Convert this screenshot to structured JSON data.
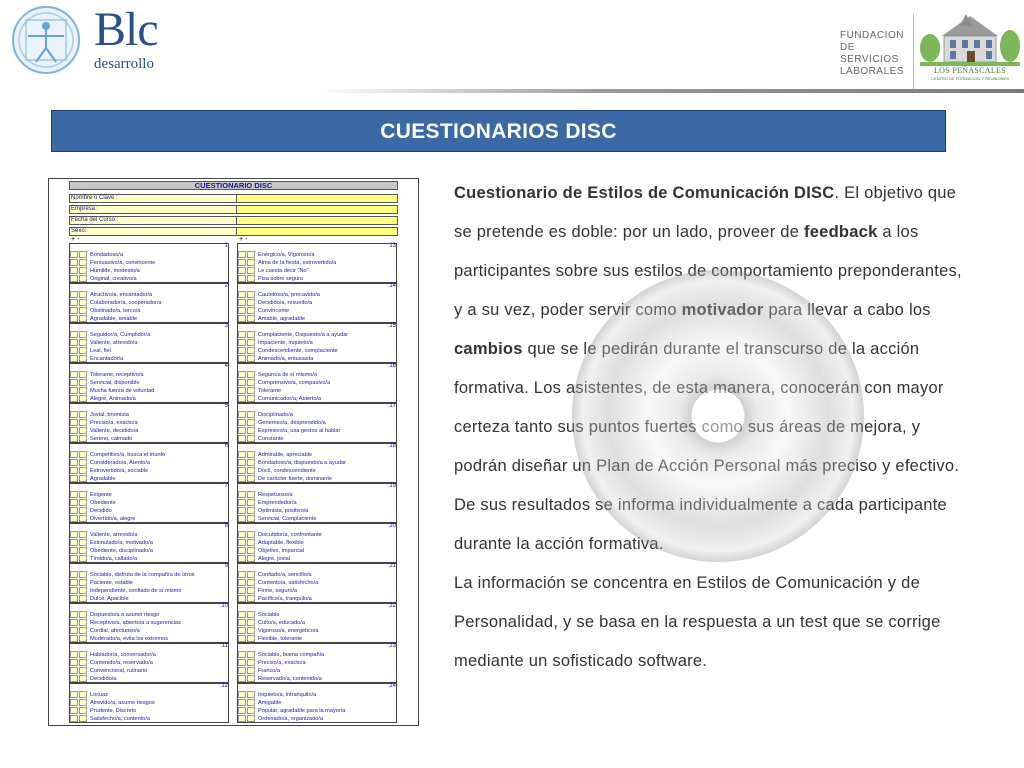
{
  "header": {
    "blc_logo": {
      "name": "Blc",
      "sub": "desarrollo"
    },
    "fsl_logo": {
      "lines": [
        "FUNDACION",
        "DE SERVICIOS",
        "LABORALES"
      ]
    },
    "penascales_logo": {
      "name": "LOS PEÑASCALES",
      "sub": "CENTRO DE FORMACION Y REUNIONES"
    }
  },
  "banner": {
    "title": "CUESTIONARIOS DISC"
  },
  "form": {
    "title": "CUESTIONARIO DISC",
    "fields": [
      "Nombre o Clave :",
      "Empresa :",
      "Fecha del Curso :",
      "Sexo:"
    ],
    "plus_minus": "+  -",
    "left_groups": [
      {
        "num": "1",
        "items": [
          "Bondadoso/a",
          "Persuasivo/a, convincente",
          "Humilde, modesto/a",
          "Original, creativo/a"
        ]
      },
      {
        "num": "2",
        "items": [
          "Atractivo/a, encantador/a",
          "Colaborador/a, cooperador/a",
          "Obstinado/a, terco/a",
          "Agradable, amable"
        ]
      },
      {
        "num": "3",
        "items": [
          "Seguidor/a, Cumplidor/a",
          "Valiente, atrevido/a",
          "Leal, fiel",
          "Encantador/a"
        ]
      },
      {
        "num": "4",
        "items": [
          "Tolerante, receptivo/a",
          "Servicial, disponible",
          "Mucha fuerza de voluntad",
          "Alegre, Animado/a"
        ]
      },
      {
        "num": "5",
        "items": [
          "Jovial, bromista",
          "Preciso/a, exacto/a",
          "Valiente, decidido/a",
          "Sereno, calmado"
        ]
      },
      {
        "num": "6",
        "items": [
          "Competitivo/a, busca el triunfo",
          "Considerado/a, Atento/a",
          "Extrovertido/a, sociable",
          "Agradable"
        ]
      },
      {
        "num": "7",
        "items": [
          "Exigente",
          "Obediente",
          "Decidido",
          "Divertido/a, alegre"
        ]
      },
      {
        "num": "8",
        "items": [
          "Valiente, atrevido/a",
          "Estimulado/a, motivado/a",
          "Obediente, disciplinado/a",
          "Tímido/a, callado/a"
        ]
      },
      {
        "num": "9",
        "items": [
          "Sociable, disfruta de la compañía de otros",
          "Paciente, estable",
          "Independiente, confiado de sí mismo",
          "Dulce, Apacible"
        ]
      },
      {
        "num": "10",
        "items": [
          "Dispuesto/a a asumir riesgo",
          "Receptivo/a, abierto/a a sugerencias",
          "Cordial, afectuoso/a",
          "Moderado/a, evita los extremos"
        ]
      },
      {
        "num": "11",
        "items": [
          "Hablador/a, conversador/a",
          "Contenido/a, reservado/a",
          "Convencional, rutinario",
          "Decidido/a"
        ]
      },
      {
        "num": "12",
        "items": [
          "Locuaz",
          "Atrevido/a, asume riesgos",
          "Prudente, Discreto",
          "Satisfecho/a, contento/a"
        ]
      }
    ],
    "right_groups": [
      {
        "num": "13",
        "items": [
          "Enérgico/a, Vigoroso/a",
          "Alma de la fiesta, extrovertido/a",
          "Le cuesta decir \"No\"",
          "Pisa sobre seguro"
        ]
      },
      {
        "num": "14",
        "items": [
          "Cauteloso/a, precavido/a",
          "Decidido/a, resuelto/a",
          "Convincente",
          "Amable, agradable"
        ]
      },
      {
        "num": "15",
        "items": [
          "Complaciente, Dispuesto/a a ayudar",
          "Impaciente, inquieto/a",
          "Condescendiente, complaciente",
          "Animado/a, entusiasta"
        ]
      },
      {
        "num": "16",
        "items": [
          "Seguro/a de sí mismo/a",
          "Comprensivo/a, compasivo/a",
          "Tolerante",
          "Comunicador/a, Abierto/a"
        ]
      },
      {
        "num": "17",
        "items": [
          "Disciplinado/a",
          "Generoso/a, desprendido/a",
          "Expresivo/a, usa gestos al hablar",
          "Constante"
        ]
      },
      {
        "num": "18",
        "items": [
          "Admirable, apreciable",
          "Bondadoso/a, dispuesto/a a ayudar",
          "Dócil, condescendiente",
          "De carácter fuerte, dominante"
        ]
      },
      {
        "num": "19",
        "items": [
          "Respetuoso/a",
          "Emprendedor/a",
          "Optimista, positivo/a",
          "Servicial, Complaciente"
        ]
      },
      {
        "num": "20",
        "items": [
          "Discutidor/a, confrontante",
          "Adaptable, flexible",
          "Objetivo, imparcial",
          "Alegre, jovial"
        ]
      },
      {
        "num": "21",
        "items": [
          "Confiado/a, sencillo/a",
          "Contento/a, satisfecho/a",
          "Firme, seguro/a",
          "Pacífico/a, tranquilo/a"
        ]
      },
      {
        "num": "22",
        "items": [
          "Sociable",
          "Culto/a, educado/a",
          "Vigoroso/a, energético/a",
          "Flexible, tolerante"
        ]
      },
      {
        "num": "23",
        "items": [
          "Sociable, buena compañía",
          "Preciso/a, exacto/a",
          "Franco/a",
          "Reservado/a, contenido/a"
        ]
      },
      {
        "num": "24",
        "items": [
          "Inquieto/a, intranquilo/a",
          "Amigable",
          "Popular, agradable para la mayoría",
          "Ordenado/a, organizado/a"
        ]
      }
    ]
  },
  "body": {
    "p1": [
      {
        "b": true,
        "t": "Cuestionario de Estilos de Comunicación DISC"
      },
      {
        "b": false,
        "t": ". El objetivo que se pretende es doble: por un lado, proveer de "
      },
      {
        "b": true,
        "t": "feedback"
      },
      {
        "b": false,
        "t": " a los participantes sobre sus estilos de comportamiento preponderantes, y a su vez, poder servir como "
      },
      {
        "b": true,
        "t": "motivador"
      },
      {
        "b": false,
        "t": " para llevar a cabo los "
      },
      {
        "b": true,
        "t": "cambios"
      },
      {
        "b": false,
        "t": " que se le pedirán durante el transcurso de la acción formativa. Los asistentes, de esta manera, conocerán con mayor certeza tanto sus puntos fuertes como sus áreas de mejora, y podrán diseñar un Plan de Acción Personal más preciso y efectivo. De sus resultados se informa individualmente a cada participante durante la acción formativa."
      }
    ],
    "p2": "La información se concentra en Estilos de Comunicación y de Personalidad, y se basa en la respuesta a un test que se corrige mediante un sofisticado software."
  }
}
